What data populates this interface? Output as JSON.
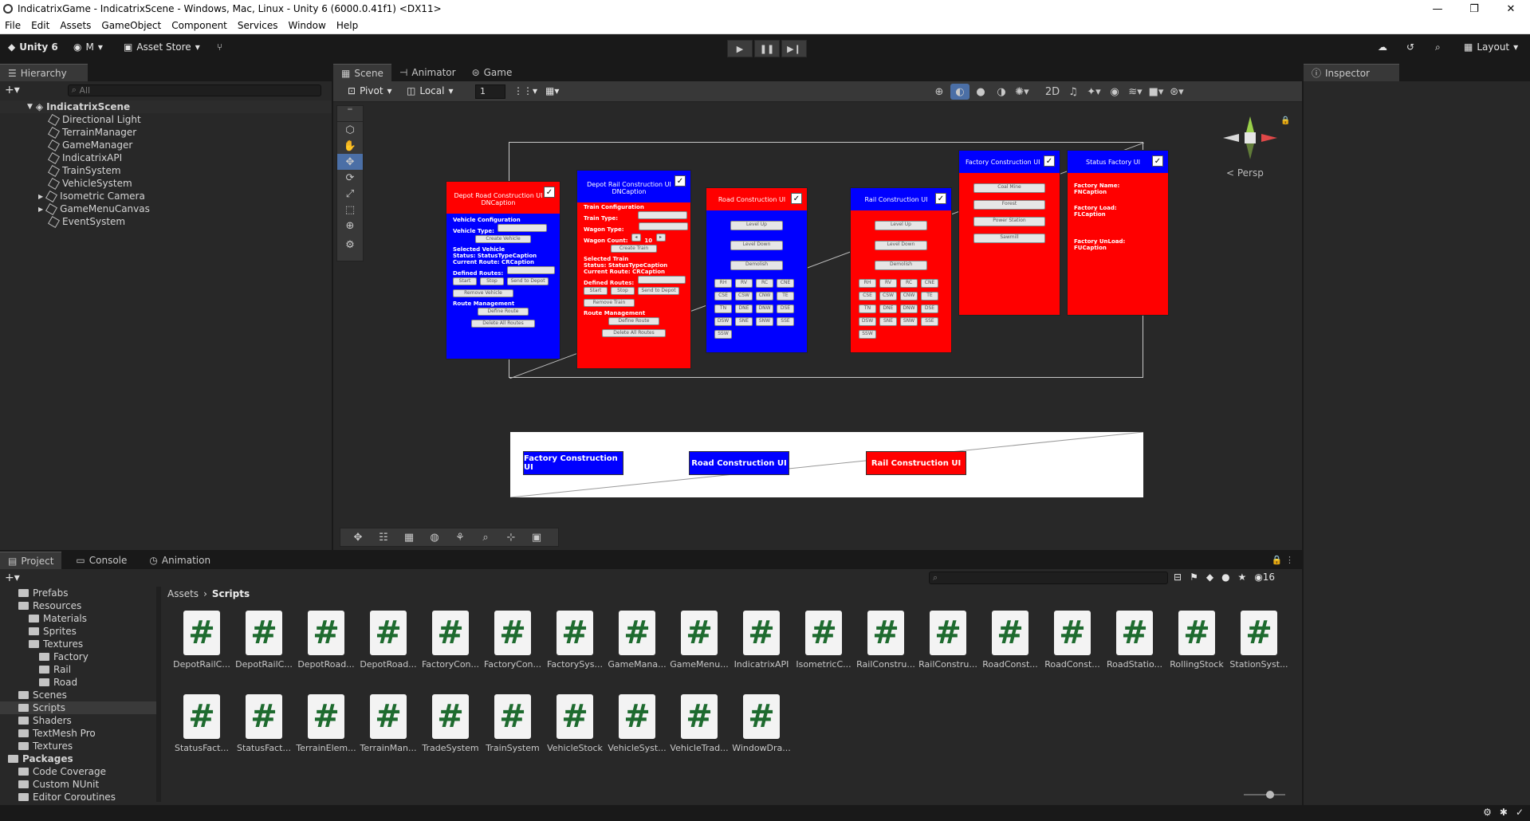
{
  "window": {
    "title": "IndicatrixGame - IndicatrixScene - Windows, Mac, Linux - Unity 6 (6000.0.41f1) <DX11>",
    "controls": [
      "—",
      "❐",
      "✕"
    ]
  },
  "menu": [
    "File",
    "Edit",
    "Assets",
    "GameObject",
    "Component",
    "Services",
    "Window",
    "Help"
  ],
  "toolbar": {
    "unity_label": "Unity 6",
    "account_label": "M",
    "asset_store_label": "Asset Store",
    "layout_label": "Layout"
  },
  "hierarchy": {
    "tab": "Hierarchy",
    "search_placeholder": "All",
    "scene_name": "IndicatrixScene",
    "items": [
      "Directional Light",
      "TerrainManager",
      "GameManager",
      "IndicatrixAPI",
      "TrainSystem",
      "VehicleSystem",
      "Isometric Camera",
      "GameMenuCanvas",
      "EventSystem"
    ]
  },
  "scene": {
    "tabs": [
      "Scene",
      "Animator",
      "Game"
    ],
    "pivot_label": "Pivot",
    "local_label": "Local",
    "grid_value": "1",
    "persp_label": "< Persp",
    "panels": {
      "depot_road": {
        "title": "Depot Road Construction UI",
        "caption": "DNCaption",
        "lines": [
          "Vehicle Configuration",
          "Vehicle Type:",
          "Selected Vehicle",
          "Status: StatusTypeCaption",
          "Current Route: CRCaption",
          "Defined Routes:",
          "Route Management"
        ],
        "buttons": [
          "Create Vehicle",
          "Start",
          "Stop",
          "Send to Depot",
          "Remove Vehicle",
          "Define Route",
          "Delete All Routes"
        ]
      },
      "depot_rail": {
        "title": "Depot Rail Construction UI",
        "caption": "DNCaption",
        "lines": [
          "Train Configuration",
          "Train Type:",
          "Wagon Type:",
          "Wagon Count:",
          "Selected Train",
          "Status: StatusTypeCaption",
          "Current Route: CRCaption",
          "Defined Routes:",
          "Route Management"
        ],
        "wagon_count": "10",
        "buttons": [
          "Create Train",
          "Start",
          "Stop",
          "Send to Depot",
          "Remove Train",
          "Define Route",
          "Delete All Routes"
        ]
      },
      "road": {
        "title": "Road Construction UI",
        "buttons": [
          "Level Up",
          "Level Down",
          "Demolish"
        ],
        "grid": [
          "RH",
          "RV",
          "RC",
          "CNE",
          "CSE",
          "CSW",
          "CNW",
          "TE",
          "TN",
          "DNE",
          "DNW",
          "DSE",
          "DSW",
          "SNE",
          "SNW",
          "SSE",
          "SSW"
        ]
      },
      "rail": {
        "title": "Rail Construction UI",
        "buttons": [
          "Level Up",
          "Level Down",
          "Demolish"
        ],
        "grid": [
          "RH",
          "RV",
          "RC",
          "CNE",
          "CSE",
          "CSW",
          "CNW",
          "TE",
          "TN",
          "DNE",
          "DNW",
          "DSE",
          "DSW",
          "SNE",
          "SNW",
          "SSE",
          "SSW"
        ]
      },
      "factory": {
        "title": "Factory Construction UI",
        "buttons": [
          "Coal Mine",
          "Forest",
          "Power Station",
          "Sawmill"
        ]
      },
      "status_factory": {
        "title": "Status Factory UI",
        "lines": [
          "Factory Name:",
          "FNCaption",
          "Factory Load:",
          "FLCaption",
          "Factory UnLoad:",
          "FUCaption"
        ]
      }
    },
    "menu_buttons": [
      "Factory Construction UI",
      "Road Construction UI",
      "Rail Construction UI"
    ]
  },
  "inspector": {
    "tab": "Inspector"
  },
  "project": {
    "tabs": [
      "Project",
      "Console",
      "Animation"
    ],
    "breadcrumb": [
      "Assets",
      "Scripts"
    ],
    "hidden_count": "16",
    "tree": [
      {
        "label": "Prefabs",
        "indent": 1
      },
      {
        "label": "Resources",
        "indent": 1
      },
      {
        "label": "Materials",
        "indent": 2
      },
      {
        "label": "Sprites",
        "indent": 2
      },
      {
        "label": "Textures",
        "indent": 2
      },
      {
        "label": "Factory",
        "indent": 3
      },
      {
        "label": "Rail",
        "indent": 3
      },
      {
        "label": "Road",
        "indent": 3
      },
      {
        "label": "Scenes",
        "indent": 1
      },
      {
        "label": "Scripts",
        "indent": 1
      },
      {
        "label": "Shaders",
        "indent": 1
      },
      {
        "label": "TextMesh Pro",
        "indent": 1
      },
      {
        "label": "Textures",
        "indent": 1
      },
      {
        "label": "Packages",
        "indent": 0
      },
      {
        "label": "Code Coverage",
        "indent": 1
      },
      {
        "label": "Custom NUnit",
        "indent": 1
      },
      {
        "label": "Editor Coroutines",
        "indent": 1
      }
    ],
    "assets": [
      "DepotRailC...",
      "DepotRailC...",
      "DepotRoad...",
      "DepotRoad...",
      "FactoryCon...",
      "FactoryCon...",
      "FactorySys...",
      "GameMana...",
      "GameMenu...",
      "IndicatrixAPI",
      "IsometricC...",
      "RailConstru...",
      "RailConstru...",
      "RoadConst...",
      "RoadConst...",
      "RoadStatio...",
      "RollingStock",
      "StationSyst...",
      "StatusFact...",
      "StatusFact...",
      "TerrainElem...",
      "TerrainMan...",
      "TradeSystem",
      "TrainSystem",
      "VehicleStock",
      "VehicleSyst...",
      "VehicleTrad...",
      "WindowDra..."
    ]
  }
}
